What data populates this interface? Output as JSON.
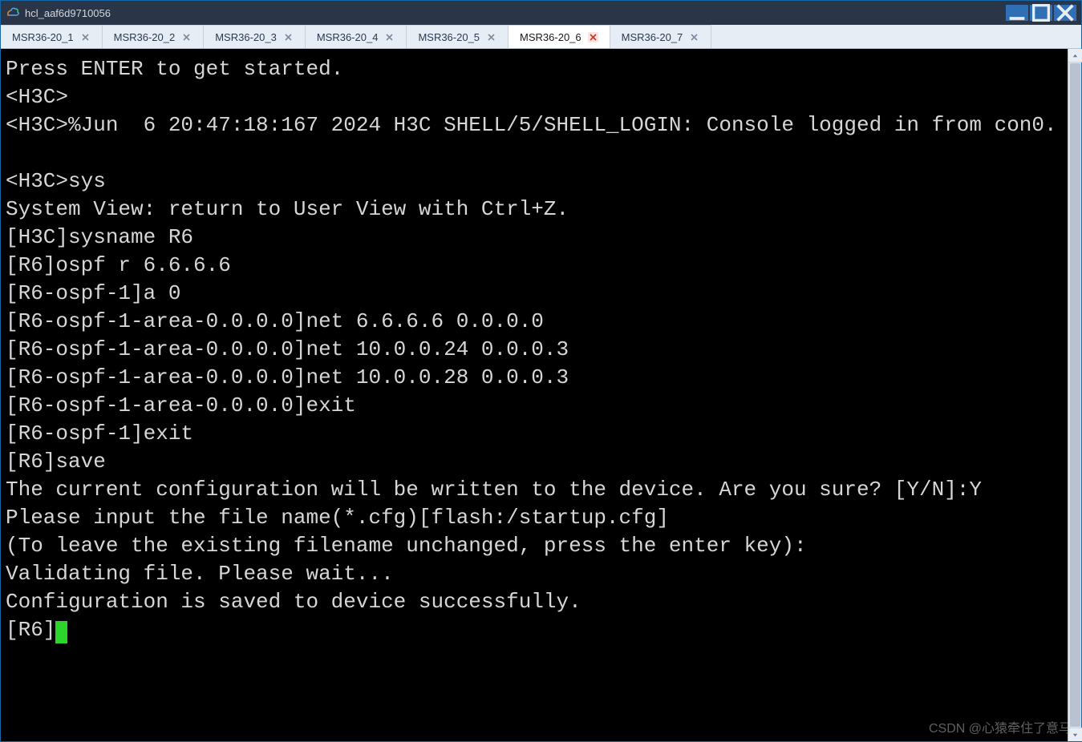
{
  "window": {
    "title": "hcl_aaf6d9710056"
  },
  "tabs": [
    {
      "label": "MSR36-20_1",
      "active": false
    },
    {
      "label": "MSR36-20_2",
      "active": false
    },
    {
      "label": "MSR36-20_3",
      "active": false
    },
    {
      "label": "MSR36-20_4",
      "active": false
    },
    {
      "label": "MSR36-20_5",
      "active": false
    },
    {
      "label": "MSR36-20_6",
      "active": true
    },
    {
      "label": "MSR36-20_7",
      "active": false
    }
  ],
  "terminal": {
    "lines": [
      "Press ENTER to get started.",
      "<H3C>",
      "<H3C>%Jun  6 20:47:18:167 2024 H3C SHELL/5/SHELL_LOGIN: Console logged in from con0.",
      "",
      "<H3C>sys",
      "System View: return to User View with Ctrl+Z.",
      "[H3C]sysname R6",
      "[R6]ospf r 6.6.6.6",
      "[R6-ospf-1]a 0",
      "[R6-ospf-1-area-0.0.0.0]net 6.6.6.6 0.0.0.0",
      "[R6-ospf-1-area-0.0.0.0]net 10.0.0.24 0.0.0.3",
      "[R6-ospf-1-area-0.0.0.0]net 10.0.0.28 0.0.0.3",
      "[R6-ospf-1-area-0.0.0.0]exit",
      "[R6-ospf-1]exit",
      "[R6]save",
      "The current configuration will be written to the device. Are you sure? [Y/N]:Y",
      "Please input the file name(*.cfg)[flash:/startup.cfg]",
      "(To leave the existing filename unchanged, press the enter key):",
      "Validating file. Please wait...",
      "Configuration is saved to device successfully."
    ],
    "prompt": "[R6]"
  },
  "watermark": "CSDN @心猿牵住了意马"
}
